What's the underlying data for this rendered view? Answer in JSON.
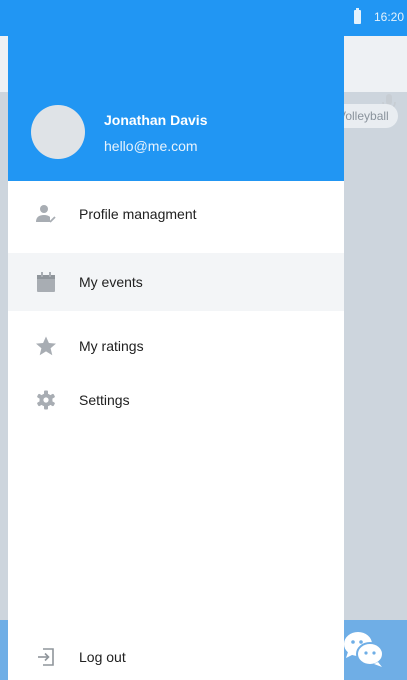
{
  "status_bar": {
    "time": "16:20"
  },
  "background": {
    "chip_label": "Volleyball"
  },
  "drawer": {
    "user": {
      "name": "Jonathan Davis",
      "email": "hello@me.com"
    },
    "items": [
      {
        "label": "Profile managment",
        "icon": "profile-manage-icon",
        "active": false
      },
      {
        "label": "My events",
        "icon": "calendar-icon",
        "active": true
      },
      {
        "label": "My ratings",
        "icon": "star-icon",
        "active": false
      },
      {
        "label": "Settings",
        "icon": "gear-icon",
        "active": false
      }
    ],
    "logout_label": "Log out"
  },
  "colors": {
    "primary": "#2196f3",
    "icon_gray": "#a8adb3",
    "active_bg": "#f3f5f7"
  }
}
